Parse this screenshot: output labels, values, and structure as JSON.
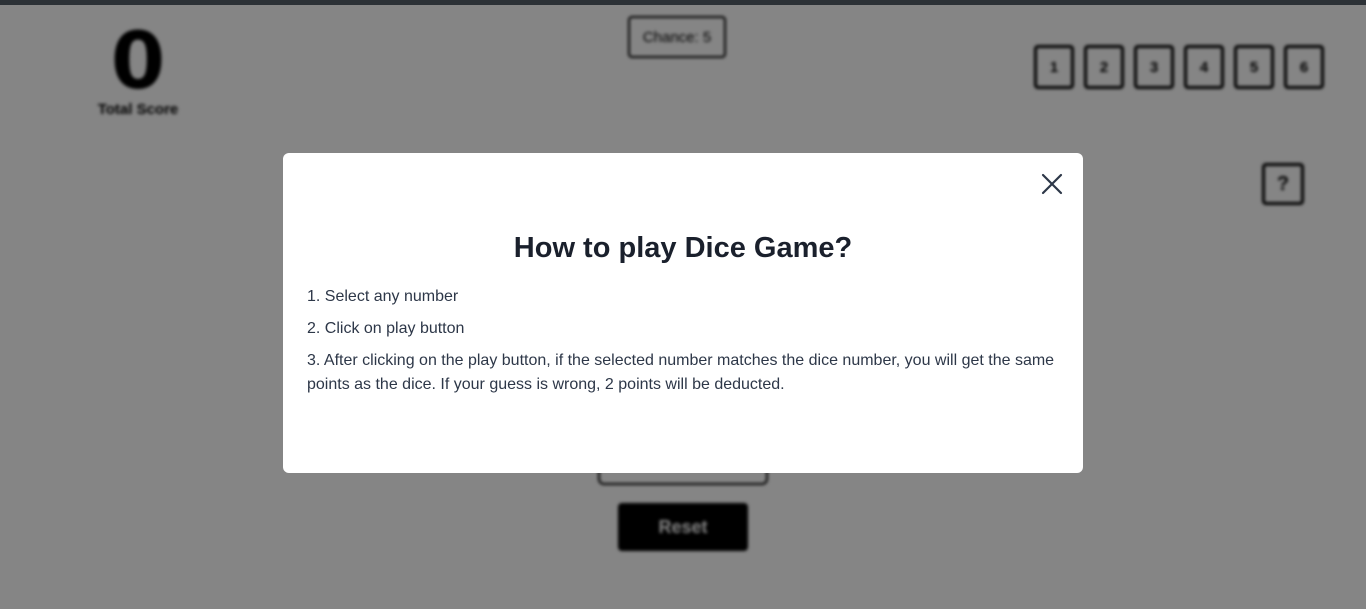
{
  "game": {
    "total_score": "0",
    "total_score_label": "Total Score",
    "chances_label": "Chance: 5",
    "numbers": [
      "1",
      "2",
      "3",
      "4",
      "5",
      "6"
    ],
    "help_label": "?",
    "reset_label": "Reset"
  },
  "modal": {
    "title": "How to play Dice Game?",
    "steps": [
      "1. Select any number",
      "2. Click on play button",
      "3. After clicking on the play button, if the selected number matches the dice number, you will get the same points as the dice. If your guess is wrong, 2 points will be deducted."
    ]
  },
  "colors": {
    "overlay": "#000000",
    "modal_bg": "#ffffff",
    "title_text": "#1a202c",
    "body_text": "#2d3748"
  }
}
